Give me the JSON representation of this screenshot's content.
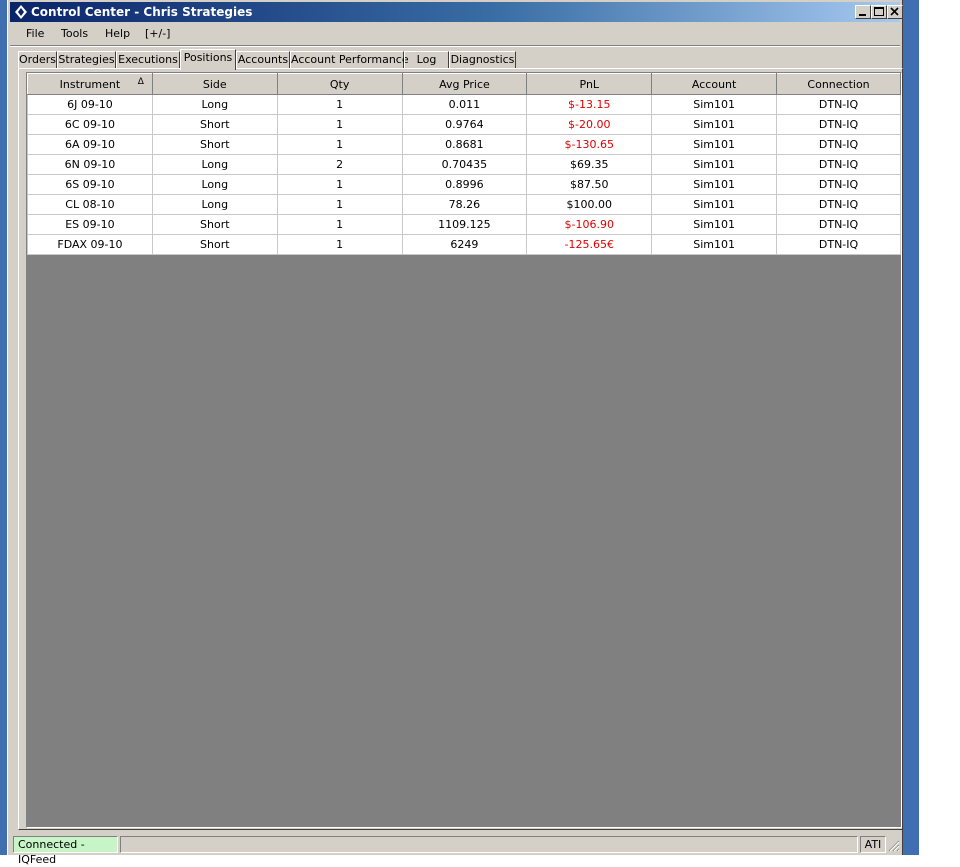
{
  "window": {
    "title": "Control Center - Chris Strategies",
    "controls": [
      "minimize-icon",
      "maximize-icon",
      "close-icon"
    ]
  },
  "menu": {
    "file": "File",
    "tools": "Tools",
    "help": "Help",
    "toggle": "[+/-]"
  },
  "tabs": [
    "Orders",
    "Strategies",
    "Executions",
    "Positions",
    "Accounts",
    "Account Performance",
    "Log",
    "Diagnostics"
  ],
  "active_tab": "Positions",
  "grid": {
    "columns": [
      "Instrument",
      "Side",
      "Qty",
      "Avg Price",
      "PnL",
      "Account",
      "Connection"
    ],
    "sort_indicator": "Δ",
    "rows": [
      {
        "instrument": "6J 09-10",
        "side": "Long",
        "qty": "1",
        "avg_price": "0.011",
        "pnl": "$-13.15",
        "pnl_negative": true,
        "account": "Sim101",
        "connection": "DTN-IQ"
      },
      {
        "instrument": "6C 09-10",
        "side": "Short",
        "qty": "1",
        "avg_price": "0.9764",
        "pnl": "$-20.00",
        "pnl_negative": true,
        "account": "Sim101",
        "connection": "DTN-IQ"
      },
      {
        "instrument": "6A 09-10",
        "side": "Short",
        "qty": "1",
        "avg_price": "0.8681",
        "pnl": "$-130.65",
        "pnl_negative": true,
        "account": "Sim101",
        "connection": "DTN-IQ"
      },
      {
        "instrument": "6N 09-10",
        "side": "Long",
        "qty": "2",
        "avg_price": "0.70435",
        "pnl": "$69.35",
        "pnl_negative": false,
        "account": "Sim101",
        "connection": "DTN-IQ"
      },
      {
        "instrument": "6S 09-10",
        "side": "Long",
        "qty": "1",
        "avg_price": "0.8996",
        "pnl": "$87.50",
        "pnl_negative": false,
        "account": "Sim101",
        "connection": "DTN-IQ"
      },
      {
        "instrument": "CL 08-10",
        "side": "Long",
        "qty": "1",
        "avg_price": "78.26",
        "pnl": "$100.00",
        "pnl_negative": false,
        "account": "Sim101",
        "connection": "DTN-IQ"
      },
      {
        "instrument": "ES 09-10",
        "side": "Short",
        "qty": "1",
        "avg_price": "1109.125",
        "pnl": "$-106.90",
        "pnl_negative": true,
        "account": "Sim101",
        "connection": "DTN-IQ"
      },
      {
        "instrument": "FDAX 09-10",
        "side": "Short",
        "qty": "1",
        "avg_price": "6249",
        "pnl": "-125.65€",
        "pnl_negative": true,
        "account": "Sim101",
        "connection": "DTN-IQ"
      }
    ]
  },
  "status": {
    "connection": "Connected - IQFeed",
    "ati": "ATI"
  },
  "colors": {
    "negative_pnl": "#e00000",
    "connected_bg": "#c7f5c7",
    "title_gradient_start": "#0a246a",
    "grid_empty_bg": "#808080"
  }
}
